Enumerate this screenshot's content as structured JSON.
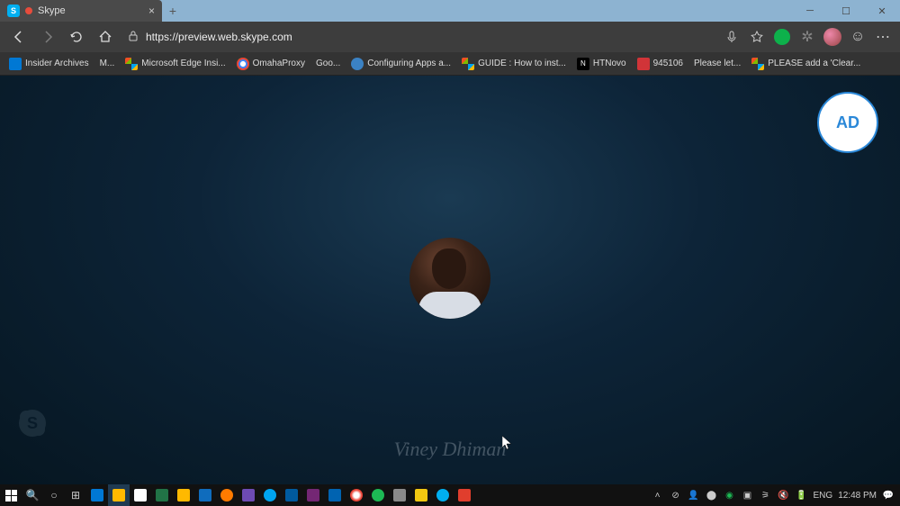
{
  "tab": {
    "title": "Skype"
  },
  "url": "https://preview.web.skype.com",
  "bookmarks": [
    {
      "label": "Insider Archives",
      "color": "#0078d4"
    },
    {
      "label": "M...",
      "color": "transparent"
    },
    {
      "label": "Microsoft Edge Insi...",
      "color": "linear"
    },
    {
      "label": "OmahaProxy",
      "color": "chrome"
    },
    {
      "label": "Goo...",
      "color": "transparent"
    },
    {
      "label": "Configuring Apps a...",
      "color": "#3b82c4"
    },
    {
      "label": "GUIDE : How to inst...",
      "color": "linear"
    },
    {
      "label": "HTNovo",
      "color": "#000"
    },
    {
      "label": "945106",
      "color": "#d13438"
    },
    {
      "label": "Please let...",
      "color": "transparent"
    },
    {
      "label": "PLEASE add a 'Clear...",
      "color": "linear"
    }
  ],
  "ad_text": "AD",
  "signature": "Viney Dhiman",
  "system": {
    "lang": "ENG",
    "time": "12:48 PM"
  }
}
